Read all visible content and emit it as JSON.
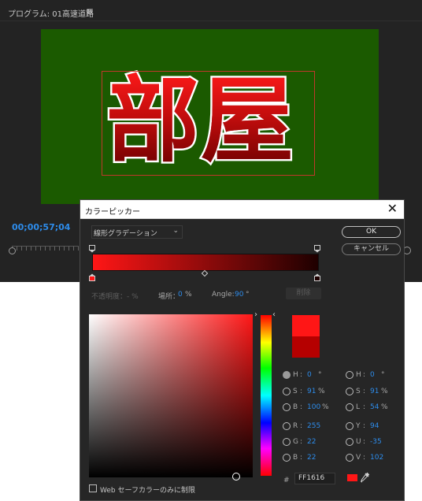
{
  "monitor": {
    "title": "プログラム: 01高速道路",
    "menu_icon": "≡",
    "video_text": "部屋",
    "timecode": "00;00;57;04"
  },
  "dialog": {
    "title": "カラーピッカー",
    "close_glyph": "✕",
    "gradient_type": "線形グラデーション",
    "ok_label": "OK",
    "cancel_label": "キャンセル",
    "opacity_label": "不透明度：- %",
    "location_label": "場所：",
    "location_value": "0",
    "location_unit": "%",
    "angle_label": "Angle:",
    "angle_value": "90",
    "angle_unit": "°",
    "delete_label": "削除",
    "hex_hash": "#",
    "hex_value": "FF1616",
    "web_safe_label": "Web セーフカラーのみに制限",
    "colors": {
      "new": "#ff1616",
      "old": "#b50000",
      "accent": "#2d8ceb"
    }
  },
  "values": {
    "hsb": [
      {
        "label": "H",
        "value": "0",
        "unit": "°",
        "selected": true
      },
      {
        "label": "S",
        "value": "91",
        "unit": "%",
        "selected": false
      },
      {
        "label": "B",
        "value": "100",
        "unit": "%",
        "selected": false
      }
    ],
    "rgb": [
      {
        "label": "R",
        "value": "255"
      },
      {
        "label": "G",
        "value": "22"
      },
      {
        "label": "B",
        "value": "22"
      }
    ],
    "hsl": [
      {
        "label": "H",
        "value": "0",
        "unit": "°"
      },
      {
        "label": "S",
        "value": "91",
        "unit": "%"
      },
      {
        "label": "L",
        "value": "54",
        "unit": "%"
      }
    ],
    "yuv": [
      {
        "label": "Y",
        "value": "94"
      },
      {
        "label": "U",
        "value": "-35"
      },
      {
        "label": "V",
        "value": "102"
      }
    ]
  }
}
